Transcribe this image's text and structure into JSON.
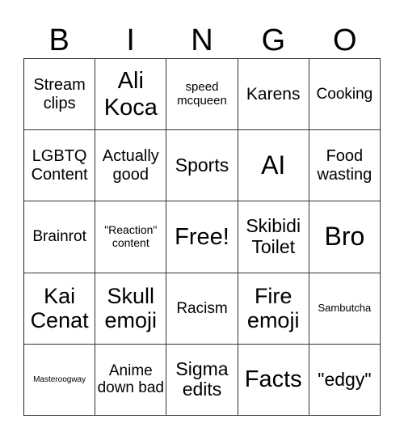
{
  "header": {
    "letters": [
      "B",
      "I",
      "N",
      "G",
      "O"
    ]
  },
  "card": {
    "rows": [
      [
        "Stream clips",
        "Ali Koca",
        "speed mcqueen",
        "Karens",
        "Cooking"
      ],
      [
        "LGBTQ Content",
        "Actually good",
        "Sports",
        "AI",
        "Food wasting"
      ],
      [
        "Brainrot",
        "\"Reaction\" content",
        "Free!",
        "Skibidi Toilet",
        "Bro"
      ],
      [
        "Kai Cenat",
        "Skull emoji",
        "Racism",
        "Fire emoji",
        "Sambutcha"
      ],
      [
        "Masteroogway",
        "Anime down bad",
        "Sigma edits",
        "Facts",
        "\"edgy\""
      ]
    ],
    "free_space": "Free!"
  }
}
